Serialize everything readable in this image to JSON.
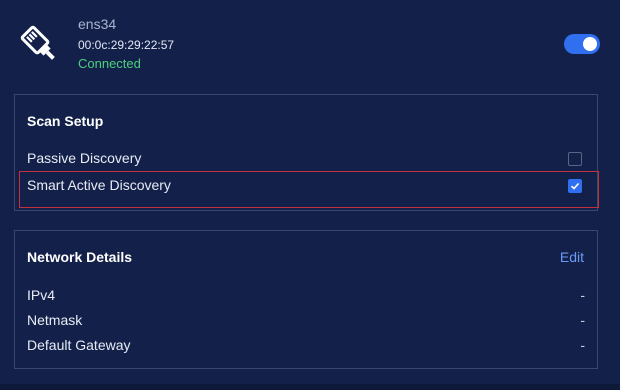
{
  "interface": {
    "name": "ens34",
    "mac": "00:0c:29:29:22:57",
    "status": "Connected",
    "status_color": "#4bd07a",
    "enabled": true,
    "icon": "ethernet-cable-icon"
  },
  "scan_setup": {
    "title": "Scan Setup",
    "options": [
      {
        "label": "Passive Discovery",
        "checked": false
      },
      {
        "label": "Smart Active Discovery",
        "checked": true,
        "highlighted": true
      }
    ]
  },
  "network_details": {
    "title": "Network Details",
    "edit_label": "Edit",
    "rows": [
      {
        "label": "IPv4",
        "value": "-"
      },
      {
        "label": "Netmask",
        "value": "-"
      },
      {
        "label": "Default Gateway",
        "value": "-"
      }
    ]
  },
  "colors": {
    "background": "#13214a",
    "accent": "#2f6ff0",
    "highlight_border": "#c2323d",
    "link": "#6a9af5"
  }
}
